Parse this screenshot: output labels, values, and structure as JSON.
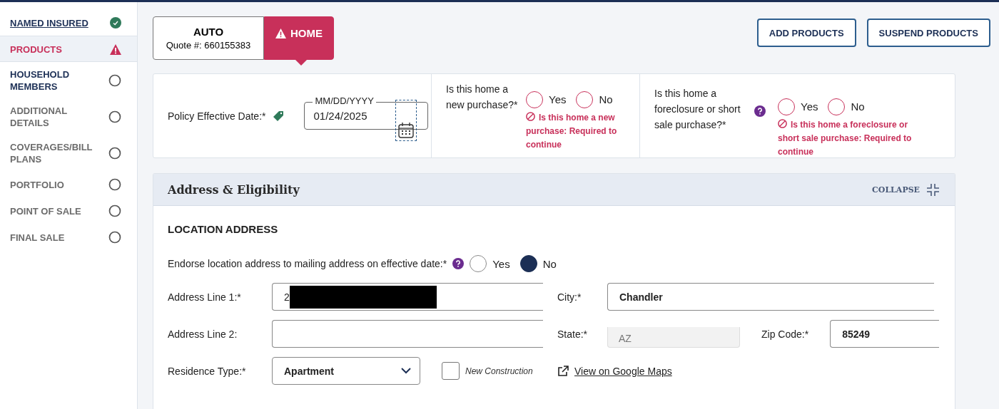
{
  "sidebar": {
    "items": [
      {
        "label": "NAMED INSURED",
        "kind": "complete",
        "selected": false
      },
      {
        "label": "PRODUCTS",
        "kind": "warning",
        "selected": true
      },
      {
        "label": "HOUSEHOLD MEMBERS",
        "kind": "next",
        "selected": false
      },
      {
        "label": "ADDITIONAL DETAILS",
        "kind": "pending",
        "selected": false
      },
      {
        "label": "COVERAGES/BILL PLANS",
        "kind": "pending",
        "selected": false
      },
      {
        "label": "PORTFOLIO",
        "kind": "pending",
        "selected": false
      },
      {
        "label": "POINT OF SALE",
        "kind": "pending",
        "selected": false
      },
      {
        "label": "FINAL SALE",
        "kind": "pending",
        "selected": false
      }
    ]
  },
  "product_tabs": [
    {
      "label": "AUTO",
      "sub": "Quote #: 660155383",
      "warning": false,
      "selected": false
    },
    {
      "label": "HOME",
      "warning": true,
      "selected": true
    }
  ],
  "header_buttons": [
    "ADD PRODUCTS",
    "SUSPEND PRODUCTS"
  ],
  "policy": {
    "date_label": "Policy Effective Date:*",
    "date_format": "MM/DD/YYYY",
    "date_value": "01/24/2025",
    "questions": [
      {
        "text": "Is this home a new purchase?*",
        "help": false,
        "options": [
          {
            "label": "Yes",
            "selected": false
          },
          {
            "label": "No",
            "selected": false
          }
        ],
        "error": "Is this home a new purchase: Required to continue"
      },
      {
        "text": "Is this home a foreclosure or short sale purchase?*",
        "help": true,
        "options": [
          {
            "label": "Yes",
            "selected": false
          },
          {
            "label": "No",
            "selected": false
          }
        ],
        "error": "Is this home a foreclosure or short sale purchase: Required to continue"
      }
    ]
  },
  "address_section": {
    "title": "Address & Eligibility",
    "collapse": "COLLAPSE",
    "subtitle": "LOCATION ADDRESS",
    "endorse": {
      "text": "Endorse location address to mailing address on effective date:*",
      "help": true,
      "options": [
        {
          "label": "Yes",
          "selected": false
        },
        {
          "label": "No",
          "selected": true
        }
      ]
    },
    "address_line_1": {
      "label": "Address Line 1:*",
      "value": "2"
    },
    "address_line_2": {
      "label": "Address Line 2:"
    },
    "city": {
      "label": "City:*",
      "value": "Chandler"
    },
    "state": {
      "label": "State:*",
      "value": "AZ",
      "disabled": true
    },
    "zip": {
      "label": "Zip Code:*",
      "value": "85249"
    },
    "residence_type": {
      "label": "Residence Type:*",
      "value": "Apartment"
    },
    "new_construction": {
      "label": "New Construction",
      "checked": false
    },
    "map_link": "View on Google Maps"
  }
}
